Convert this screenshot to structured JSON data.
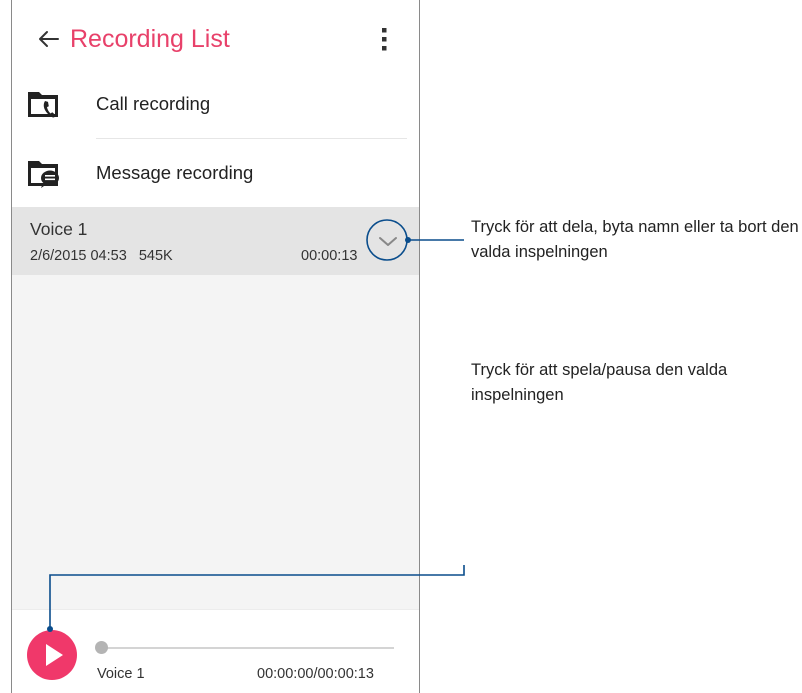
{
  "app_bar": {
    "title": "Recording List",
    "back_icon": "arrow-left-icon",
    "menu_icon": "more-vert-icon",
    "accent_color": "#e8416a"
  },
  "folders": [
    {
      "label": "Call recording",
      "icon": "call-folder-icon"
    },
    {
      "label": "Message recording",
      "icon": "message-folder-icon"
    }
  ],
  "recording": {
    "name": "Voice 1",
    "date": "2/6/2015 04:53",
    "size": "545K",
    "duration": "00:00:13",
    "expand_icon": "chevron-down-icon"
  },
  "player": {
    "play_icon": "play-icon",
    "button_color": "#f0386a",
    "track_name": "Voice 1",
    "time": "00:00:00/00:00:13",
    "progress": 0
  },
  "callouts": {
    "expand": "Tryck för att dela, byta namn eller ta bort den valda inspelningen",
    "play": "Tryck för att spela/pausa den valda inspelningen"
  }
}
